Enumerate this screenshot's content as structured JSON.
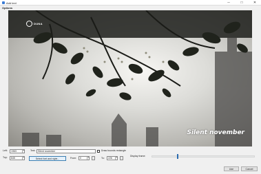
{
  "window": {
    "title": "Add text",
    "minimize_icon": "─",
    "maximize_icon": "□",
    "close_icon": "✕"
  },
  "menu": {
    "options_label": "Options"
  },
  "preview": {
    "caption": "Silent november",
    "logo_text": "DUNA"
  },
  "controls": {
    "left_label": "Left:",
    "left_value": "1963",
    "top_label": "Top:",
    "top_value": "845",
    "text_label": "Text:",
    "text_value": "Silent november",
    "draw_bounds_label": "Draw bounds rectangle",
    "select_font_label": "Select font and style...",
    "from_label": "From:",
    "from_value": "0",
    "to_label": "To:",
    "to_value": "226",
    "display_frame_label": "Display frame:",
    "display_frame_fraction": 0.25,
    "use_label": "Use",
    "cancel_label": "Cancel",
    "spin_up": "▲",
    "spin_down": "▼",
    "color_button_label": "c"
  }
}
